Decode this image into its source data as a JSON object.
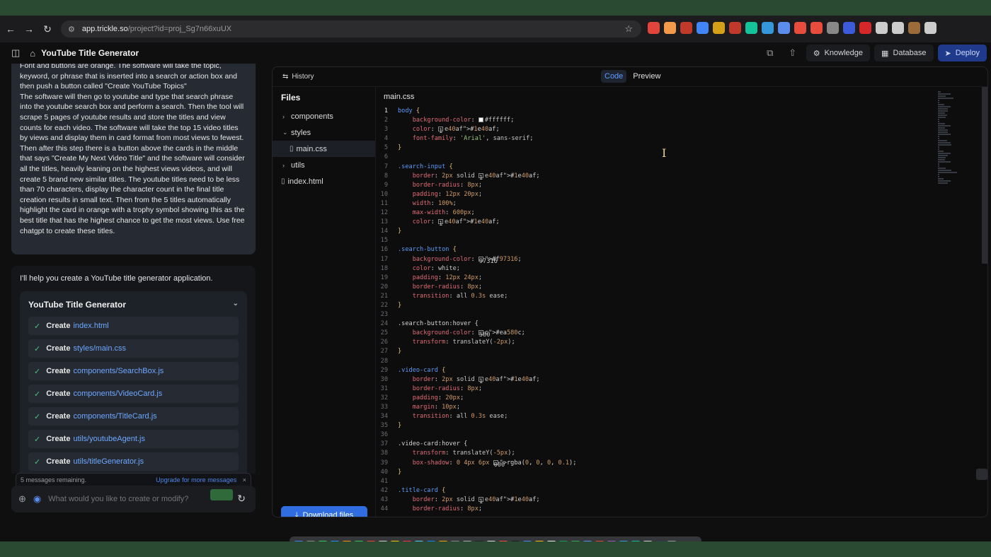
{
  "browser": {
    "url_host": "app.trickle.so",
    "url_path": "/project?id=proj_Sg7n66xuUX",
    "extensions": [
      {
        "name": "pen-icon",
        "color": "#e0443a"
      },
      {
        "name": "figma-icon",
        "color": "#f2994a"
      },
      {
        "name": "puzzle-icon",
        "color": "#c0392b"
      },
      {
        "name": "drop-icon",
        "color": "#4285f4"
      },
      {
        "name": "translate-icon",
        "color": "#d4a017"
      },
      {
        "name": "desc-icon",
        "color": "#c0392b"
      },
      {
        "name": "grammarly-icon",
        "color": "#15c39a"
      },
      {
        "name": "m-icon",
        "color": "#3498db"
      },
      {
        "name": "doc-icon",
        "color": "#5b8def"
      },
      {
        "name": "o-icon",
        "color": "#e74c3c"
      },
      {
        "name": "ai-icon",
        "color": "#e74c3c"
      },
      {
        "name": "sheet-icon",
        "color": "#888888"
      },
      {
        "name": "m2-icon",
        "color": "#3b5bdb"
      },
      {
        "name": "v-icon",
        "color": "#d62828"
      },
      {
        "name": "extensions-icon",
        "color": "#cccccc"
      },
      {
        "name": "download-icon",
        "color": "#cccccc"
      },
      {
        "name": "profile-icon",
        "color": "#9b6b3a"
      },
      {
        "name": "menu-icon",
        "color": "#cccccc"
      }
    ]
  },
  "header": {
    "title": "YouTube Title Generator",
    "knowledge_label": "Knowledge",
    "database_label": "Database",
    "deploy_label": "Deploy"
  },
  "chat": {
    "user_message": "Font and buttons are orange. The software will take the topic, keyword, or phrase that is inserted into a search or action box and then push a button called \"Create YouTube Topics\"\nThe software will then go to youtube and type that search phrase into the youtube search box and perform a search. Then the tool will scrape 5 pages of youtube results and store the titles and view counts for each video. The software will take the top 15 video titles by views and display them in card format from most views to fewest. Then after this step there is a button above the cards in the middle that says \"Create My Next Video Title\" and the software will consider all the titles, heavily leaning on the highest views videos, and will create 5 brand new similar titles. The youtube titles need to be less than 70 characters, display the character count in the final title creation results in small text. Then from the 5 titles automatically highlight the card in orange with a trophy symbol showing this as the best title that has the highest chance to get the most views. Use free chatgpt to create these titles.",
    "ai_intro": "I'll help you create a YouTube title generator application.",
    "card_title": "YouTube Title Generator",
    "tasks": [
      {
        "verb": "Create",
        "path": "index.html"
      },
      {
        "verb": "Create",
        "path": "styles/main.css"
      },
      {
        "verb": "Create",
        "path": "components/SearchBox.js"
      },
      {
        "verb": "Create",
        "path": "components/VideoCard.js"
      },
      {
        "verb": "Create",
        "path": "components/TitleCard.js"
      },
      {
        "verb": "Create",
        "path": "utils/youtubeAgent.js"
      },
      {
        "verb": "Create",
        "path": "utils/titleGenerator.js"
      }
    ],
    "remaining": "5 messages remaining.",
    "upgrade": "Upgrade for more messages",
    "composer_placeholder": "What would you like to create or modify?"
  },
  "editor": {
    "history_label": "History",
    "tab_code": "Code",
    "tab_preview": "Preview",
    "files_label": "Files",
    "tree": [
      {
        "label": "components",
        "type": "folder",
        "open": false
      },
      {
        "label": "styles",
        "type": "folder",
        "open": true
      },
      {
        "label": "main.css",
        "type": "file",
        "selected": true
      },
      {
        "label": "utils",
        "type": "folder",
        "open": false
      },
      {
        "label": "index.html",
        "type": "file",
        "selected": false
      }
    ],
    "open_file": "main.css",
    "download_label": "Download files",
    "colors": {
      "accent": "#2f6de1",
      "orange": "#f97316",
      "blue_text": "#1e40af"
    },
    "code_lines": [
      "body {",
      "    background-color: #ffffff;",
      "    color: #1e40af;",
      "    font-family: 'Arial', sans-serif;",
      "}",
      "",
      ".search-input {",
      "    border: 2px solid #1e40af;",
      "    border-radius: 8px;",
      "    padding: 12px 20px;",
      "    width: 100%;",
      "    max-width: 600px;",
      "    color: #1e40af;",
      "}",
      "",
      ".search-button {",
      "    background-color: #f97316;",
      "    color: white;",
      "    padding: 12px 24px;",
      "    border-radius: 8px;",
      "    transition: all 0.3s ease;",
      "}",
      "",
      ".search-button:hover {",
      "    background-color: #ea580c;",
      "    transform: translateY(-2px);",
      "}",
      "",
      ".video-card {",
      "    border: 2px solid #1e40af;",
      "    border-radius: 8px;",
      "    padding: 20px;",
      "    margin: 10px;",
      "    transition: all 0.3s ease;",
      "}",
      "",
      ".video-card:hover {",
      "    transform: translateY(-5px);",
      "    box-shadow: 0 4px 6px rgba(0, 0, 0, 0.1);",
      "}",
      "",
      ".title-card {",
      "    border: 2px solid #1e40af;",
      "    border-radius: 8px;"
    ]
  },
  "dock": {
    "app_colors": [
      "#3b82f6",
      "#888888",
      "#34c759",
      "#1e90ff",
      "#ff9500",
      "#34c759",
      "#ff3b30",
      "#cccccc",
      "#ffcc00",
      "#ff2d55",
      "#5ac8fa",
      "#0a84ff",
      "#ff9f0a",
      "#888888",
      "#aaaaaa",
      "#222222",
      "#dddddd",
      "#ff453a",
      "#1c1c1e",
      "#4285f4",
      "#fbbc05",
      "#eeeeee",
      "#0f9d58",
      "#34a853",
      "#5b8def",
      "#ea4335",
      "#9b59b6",
      "#3498db",
      "#1abc9c",
      "#cccccc",
      "#2c3e50",
      "#999999"
    ]
  }
}
